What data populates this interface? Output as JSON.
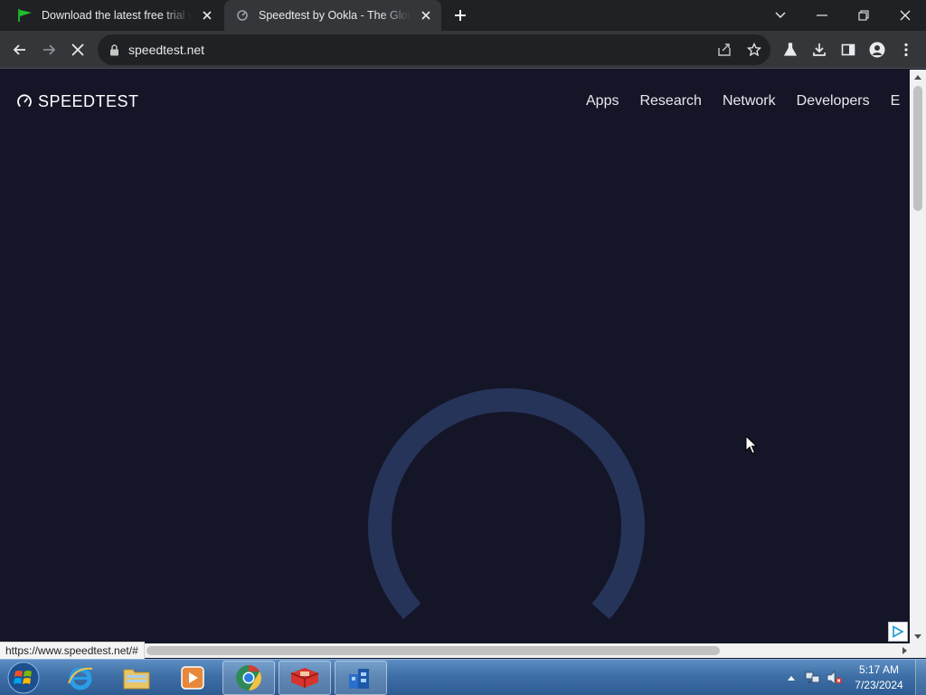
{
  "browser": {
    "tabs": [
      {
        "title": "Download the latest free trial ve",
        "active": false,
        "icon": "green-flag-icon"
      },
      {
        "title": "Speedtest by Ookla - The Global",
        "active": true,
        "icon": "speedtest-favicon-icon"
      }
    ],
    "address": {
      "url": "speedtest.net"
    }
  },
  "page": {
    "brand": {
      "name": "SPEEDTEST"
    },
    "nav": [
      {
        "label": "Apps"
      },
      {
        "label": "Research"
      },
      {
        "label": "Network"
      },
      {
        "label": "Developers"
      },
      {
        "label": "E"
      }
    ],
    "status_url": "https://www.speedtest.net/#",
    "gauge": {
      "state": "loading"
    }
  },
  "taskbar": {
    "apps": [
      {
        "name": "internet-explorer"
      },
      {
        "name": "file-explorer"
      },
      {
        "name": "media-player"
      },
      {
        "name": "chrome",
        "open": true
      },
      {
        "name": "red-app",
        "open": true
      },
      {
        "name": "blue-app",
        "open": true
      }
    ],
    "clock": {
      "time": "5:17 AM",
      "date": "7/23/2024"
    }
  },
  "colors": {
    "page_background": "#141526",
    "gauge_track": "#26345a",
    "tab_bar": "#202124",
    "toolbar": "#35363a"
  }
}
